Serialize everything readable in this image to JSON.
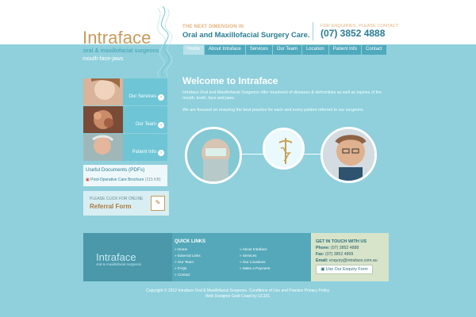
{
  "brand": {
    "name": "Intraface",
    "subtitle": "oral & maxillofacial surgeons",
    "tagline": "mouth-face-jaws"
  },
  "header": {
    "kicker": "THE NEXT DIMENSION IN",
    "title": "Oral and Maxillofacial Surgery Care.",
    "enquiry_label": "FOR ENQUIRIES, PLEASE CONTACT",
    "phone": "(07) 3852 4888"
  },
  "nav": {
    "items": [
      "Home",
      "About Intraface",
      "Services",
      "Our Team",
      "Location",
      "Patient Info",
      "Contact"
    ]
  },
  "sidebar": {
    "cards": [
      "Our Services",
      "Our Team",
      "Patient Info"
    ],
    "useful_documents": {
      "title": "Useful Documents (PDFs)",
      "doc_name": "Post-Operative Care Brochure",
      "doc_size": "(215 KB)"
    },
    "referral": {
      "line1": "PLEASE CLICK FOR ONLINE",
      "line2": "Referral Form"
    }
  },
  "main": {
    "heading": "Welcome to Intraface",
    "paragraph1": "Intraface Oral and Maxillofacial Surgeons offer treatment of diseases & deformities as well as injuries of the mouth, teeth, face and jaws.",
    "paragraph2": "We are focused on ensuring the best practice for each and every patient referred to our surgeons."
  },
  "footer": {
    "quick_links_title": "QUICK LINKS",
    "left_links": [
      "Home",
      "External Links",
      "Our Team",
      "FAQs",
      "Contact"
    ],
    "right_links": [
      "About Intraface",
      "Services",
      "Our Locations",
      "Make a Payment"
    ],
    "touch": {
      "title": "GET IN TOUCH WITH US",
      "phone_label": "Phone:",
      "phone": "(07) 3852 4888",
      "fax_label": "Fax:",
      "fax": "(07) 3852 4899",
      "email_label": "Email:",
      "email": "enquiry@intraface.com.au",
      "button": "Use Our Enquiry Form"
    }
  },
  "copyright": "Copyright © 2012 Intraface Oral & Maxillofacial Surgeons. Conditions of Use and Practice Privacy Policy.",
  "credit": "Web Designer Gold Coast by GCDS.",
  "icons": {
    "arrow": "arrow-icon",
    "pdf": "pdf-icon",
    "form": "form-icon"
  },
  "colors": {
    "background": "#8fd0dc",
    "accent": "#2a7d93",
    "gold": "#c99a5a"
  }
}
